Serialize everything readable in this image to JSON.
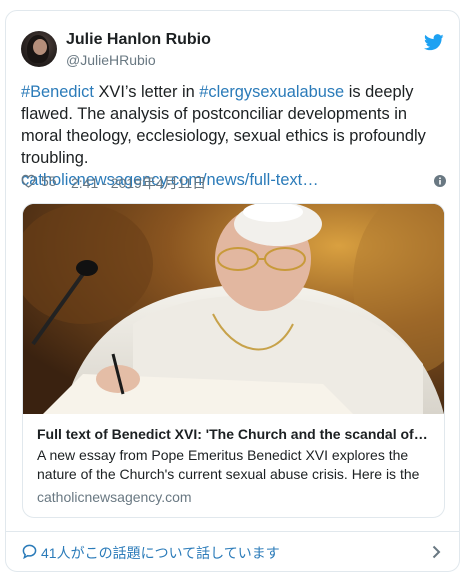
{
  "author": {
    "name": "Julie Hanlon Rubio",
    "handle": "@JulieHRubio"
  },
  "tweet": {
    "hashtag1": "#Benedict",
    "text1": " XVI’s letter in ",
    "hashtag2": "#clergysexualabuse",
    "text2": " is deeply flawed. The analysis of postconciliar developments in moral theology, ecclesiology, sexual ethics is profoundly troubling.",
    "link": "catholicnewsagency.com/news/full-text…"
  },
  "meta": {
    "likes": "55",
    "timestamp": "2:41 - 2019年4月11日"
  },
  "card": {
    "title": "Full text of Benedict XVI: 'The Church and the scandal of…",
    "description": "A new essay from Pope Emeritus Benedict XVI explores the nature of the Church's current sexual abuse crisis. Here is the",
    "domain": "catholicnewsagency.com"
  },
  "footer": {
    "text": "41人がこの話題について話しています"
  },
  "icons": {
    "bird": "twitter-bird-icon",
    "heart": "heart-icon",
    "info": "info-icon",
    "chat": "speech-bubble-icon",
    "chevron": "chevron-right-icon"
  },
  "colors": {
    "link": "#2b7bb9",
    "muted": "#697882",
    "twitter_blue": "#1da1f2",
    "border": "#e1e8ed"
  }
}
